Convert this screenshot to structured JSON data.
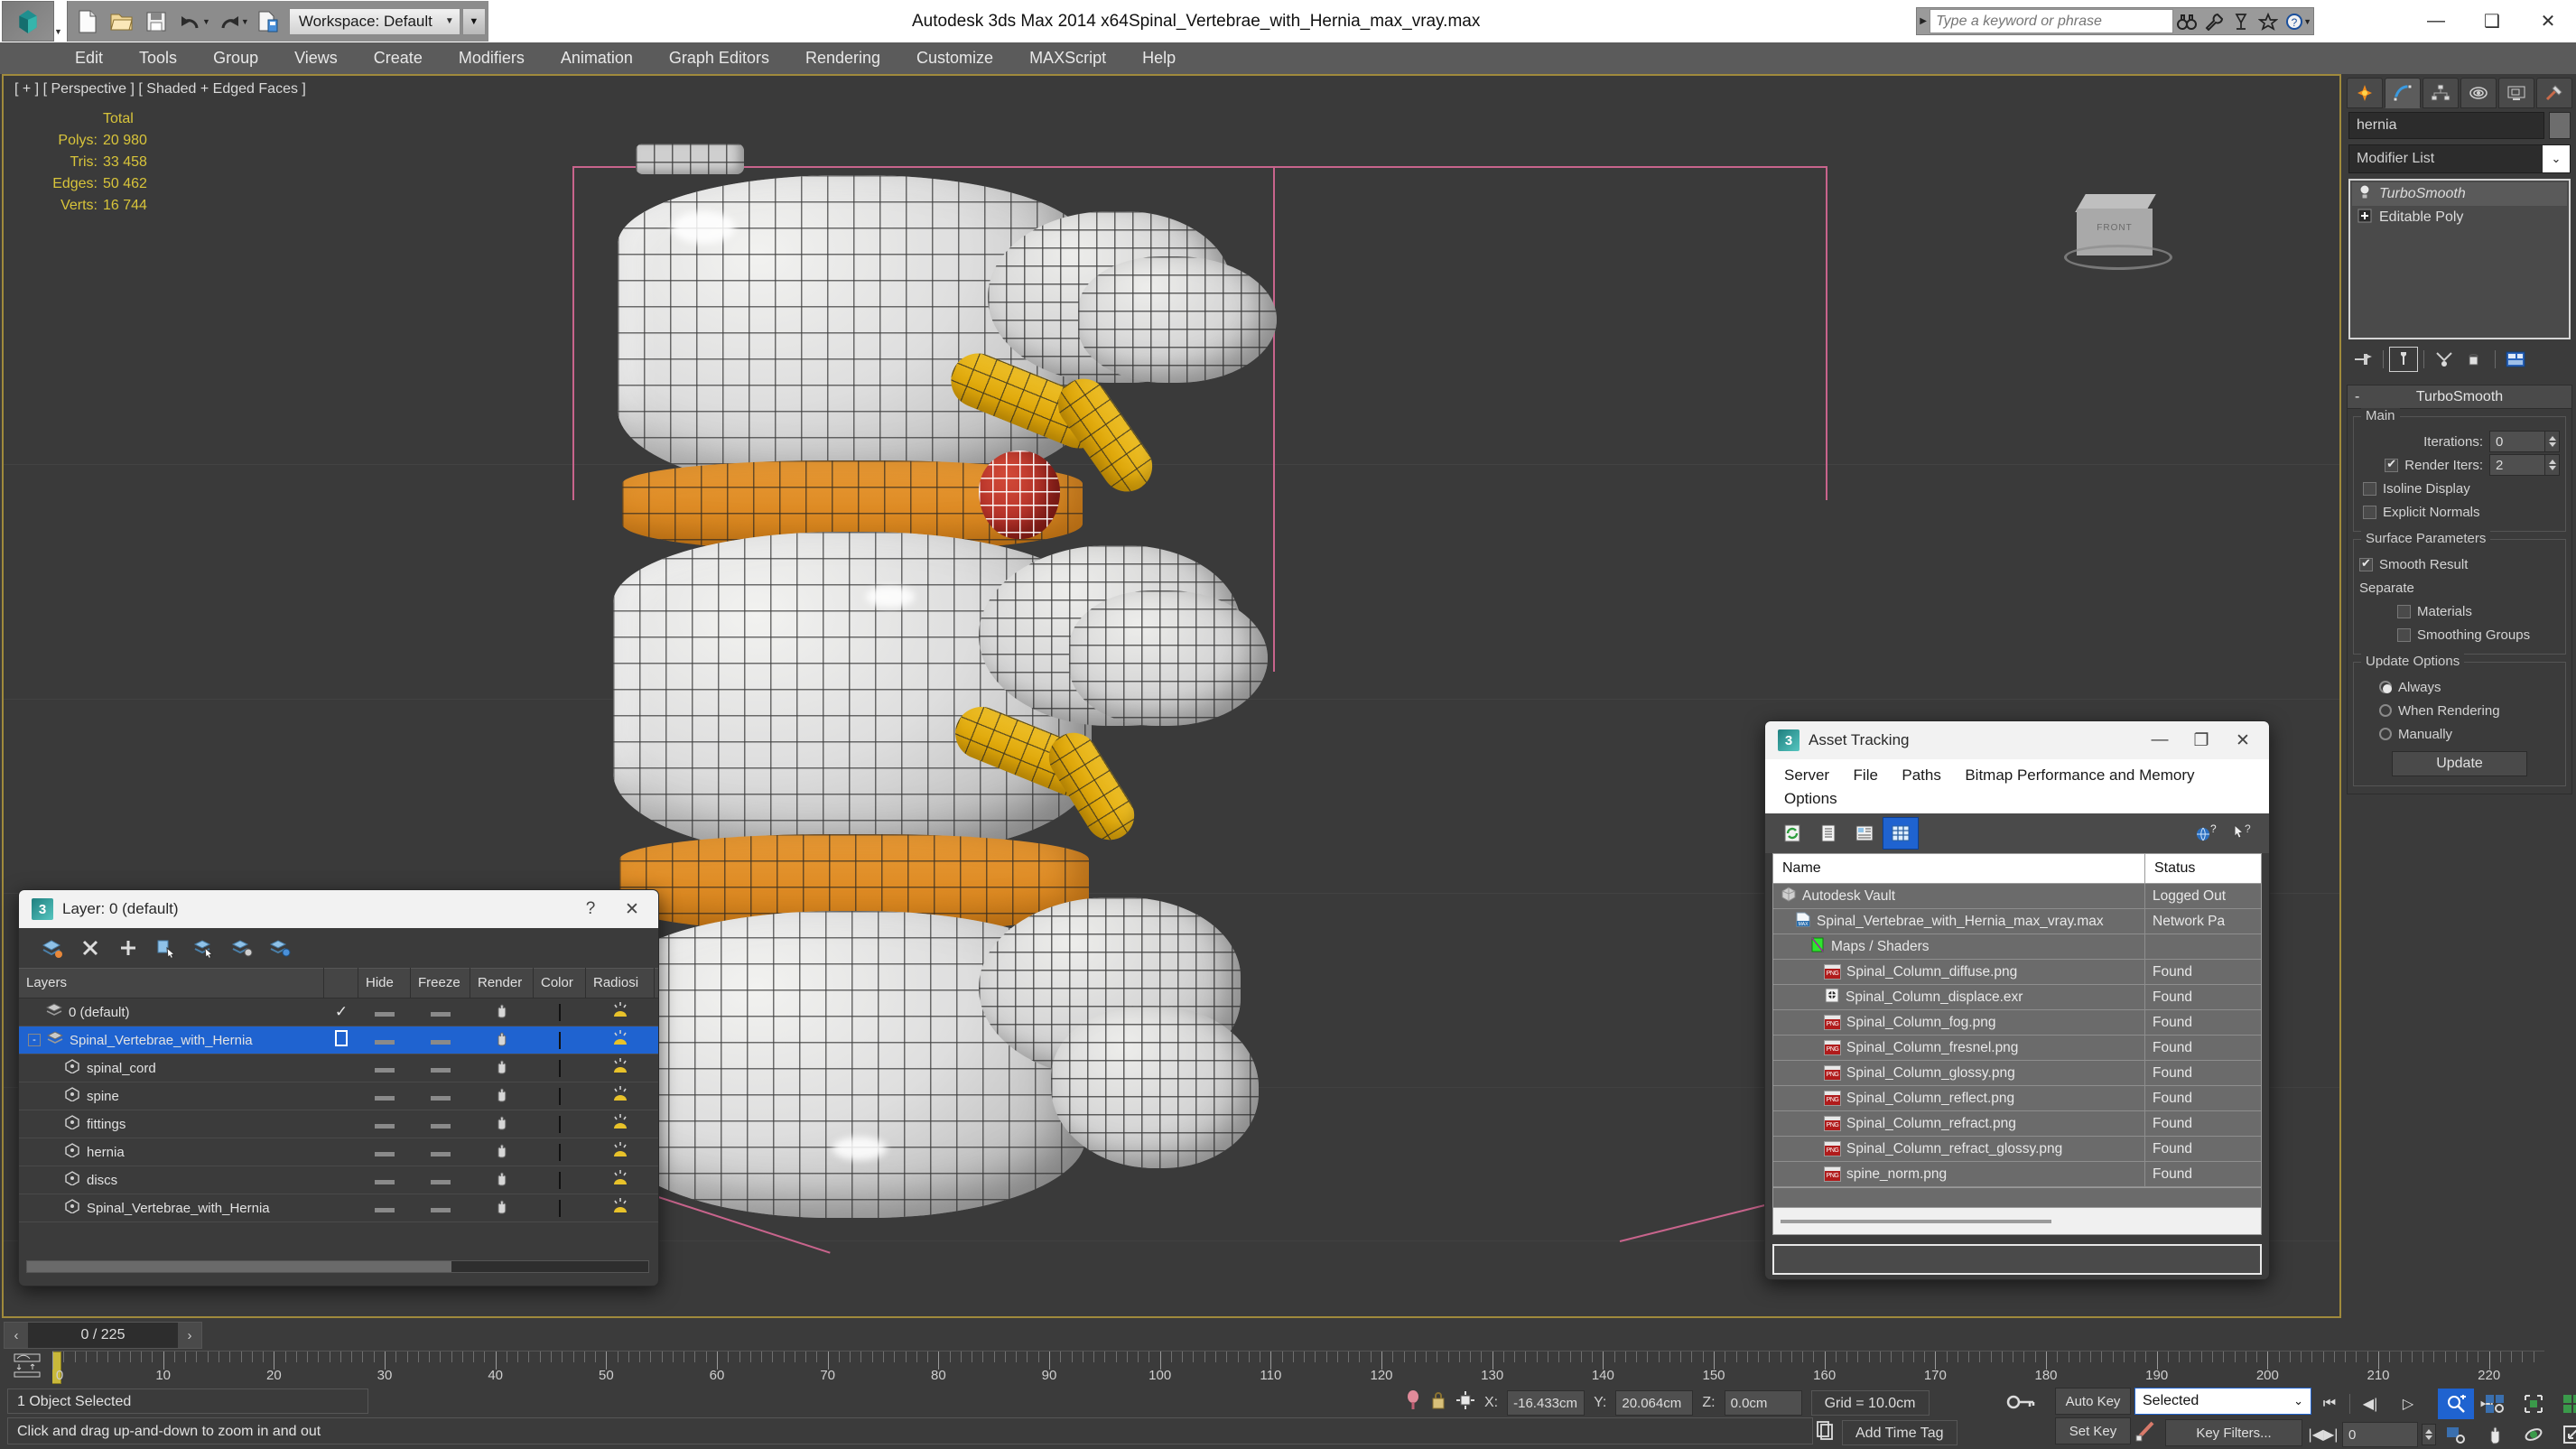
{
  "titlebar": {
    "workspace": "Workspace: Default",
    "app_title": "Autodesk 3ds Max  2014 x64",
    "file_title": "Spinal_Vertebrae_with_Hernia_max_vray.max",
    "search_placeholder": "Type a keyword or phrase",
    "quick_access": [
      "new-file",
      "open-file",
      "save-file",
      "undo",
      "redo",
      "set-project-folder"
    ],
    "window_controls": {
      "minimize": "—",
      "maximize": "❑",
      "close": "✕"
    }
  },
  "menubar": {
    "items": [
      "Edit",
      "Tools",
      "Group",
      "Views",
      "Create",
      "Modifiers",
      "Animation",
      "Graph Editors",
      "Rendering",
      "Customize",
      "MAXScript",
      "Help"
    ]
  },
  "viewport": {
    "label": "[ + ] [ Perspective ] [ Shaded + Edged Faces ]",
    "stats": {
      "header": "Total",
      "rows": [
        {
          "label": "Polys:",
          "value": "20 980"
        },
        {
          "label": "Tris:",
          "value": "33 458"
        },
        {
          "label": "Edges:",
          "value": "50 462"
        },
        {
          "label": "Verts:",
          "value": "16 744"
        }
      ]
    },
    "viewcube_label": "FRONT"
  },
  "layer_dialog": {
    "title": "Layer: 0 (default)",
    "help_btn": "?",
    "close_btn": "✕",
    "toolbar": [
      "new-layer-icon",
      "delete-layer-icon",
      "add-layer-icon",
      "select-objects-in-layer-icon",
      "select-highlighted-objects-icon",
      "highlight-selected-objects-icon",
      "layer-properties-icon"
    ],
    "columns": [
      "Layers",
      "",
      "Hide",
      "Freeze",
      "Render",
      "Color",
      "Radiosi"
    ],
    "rows": [
      {
        "name": "0 (default)",
        "indent": 1,
        "selected": false,
        "current": true,
        "kind": "layer"
      },
      {
        "name": "Spinal_Vertebrae_with_Hernia",
        "indent": 0,
        "selected": true,
        "current": false,
        "kind": "layer"
      },
      {
        "name": "spinal_cord",
        "indent": 2,
        "selected": false,
        "current": false,
        "kind": "object"
      },
      {
        "name": "spine",
        "indent": 2,
        "selected": false,
        "current": false,
        "kind": "object"
      },
      {
        "name": "fittings",
        "indent": 2,
        "selected": false,
        "current": false,
        "kind": "object"
      },
      {
        "name": "hernia",
        "indent": 2,
        "selected": false,
        "current": false,
        "kind": "object"
      },
      {
        "name": "discs",
        "indent": 2,
        "selected": false,
        "current": false,
        "kind": "object"
      },
      {
        "name": "Spinal_Vertebrae_with_Hernia",
        "indent": 2,
        "selected": false,
        "current": false,
        "kind": "object"
      }
    ]
  },
  "asset_tracking": {
    "title": "Asset Tracking",
    "menu": [
      "Server",
      "File",
      "Paths",
      "Bitmap Performance and Memory",
      "Options"
    ],
    "toolbar": [
      "refresh-icon",
      "list-view-icon",
      "details-view-icon",
      "grid-view-icon"
    ],
    "help_icons": [
      "help-globe-icon",
      "help-arrow-icon"
    ],
    "columns": [
      "Name",
      "Status"
    ],
    "rows": [
      {
        "name": "Autodesk Vault",
        "status": "Logged Out",
        "indent": 0,
        "icon": "vault-icon"
      },
      {
        "name": "Spinal_Vertebrae_with_Hernia_max_vray.max",
        "status": "Network Pa",
        "indent": 1,
        "icon": "max-file-icon"
      },
      {
        "name": "Maps / Shaders",
        "status": "",
        "indent": 2,
        "icon": "maps-shaders-icon"
      },
      {
        "name": "Spinal_Column_diffuse.png",
        "status": "Found",
        "indent": 3,
        "icon": "png-icon"
      },
      {
        "name": "Spinal_Column_displace.exr",
        "status": "Found",
        "indent": 3,
        "icon": "exr-icon"
      },
      {
        "name": "Spinal_Column_fog.png",
        "status": "Found",
        "indent": 3,
        "icon": "png-icon"
      },
      {
        "name": "Spinal_Column_fresnel.png",
        "status": "Found",
        "indent": 3,
        "icon": "png-icon"
      },
      {
        "name": "Spinal_Column_glossy.png",
        "status": "Found",
        "indent": 3,
        "icon": "png-icon"
      },
      {
        "name": "Spinal_Column_reflect.png",
        "status": "Found",
        "indent": 3,
        "icon": "png-icon"
      },
      {
        "name": "Spinal_Column_refract.png",
        "status": "Found",
        "indent": 3,
        "icon": "png-icon"
      },
      {
        "name": "Spinal_Column_refract_glossy.png",
        "status": "Found",
        "indent": 3,
        "icon": "png-icon"
      },
      {
        "name": "spine_norm.png",
        "status": "Found",
        "indent": 3,
        "icon": "png-icon"
      }
    ],
    "path_field": "",
    "status_field": ""
  },
  "command_panel": {
    "tabs": [
      "create-tab",
      "modify-tab",
      "hierarchy-tab",
      "motion-tab",
      "display-tab",
      "utilities-tab"
    ],
    "active_tab_index": 1,
    "object_name": "hernia",
    "modifier_list_label": "Modifier List",
    "stack": [
      {
        "label": "TurboSmooth",
        "active": true,
        "icon": "light-bulb-icon"
      },
      {
        "label": "Editable Poly",
        "active": false,
        "icon": "plus-expand-icon"
      }
    ],
    "rollout": {
      "title": "TurboSmooth",
      "minus": "-",
      "groups": [
        {
          "label": "Main",
          "fields": [
            {
              "type": "spinner",
              "label": "Iterations:",
              "value": "0"
            },
            {
              "type": "check_spinner",
              "label": "Render Iters:",
              "value": "2",
              "checked": true
            },
            {
              "type": "checkbox",
              "label": "Isoline Display",
              "checked": false
            },
            {
              "type": "checkbox",
              "label": "Explicit Normals",
              "checked": false
            }
          ]
        },
        {
          "label": "Surface Parameters",
          "fields": [
            {
              "type": "checkbox",
              "label": "Smooth Result",
              "checked": true
            },
            {
              "type": "text",
              "label": "Separate"
            },
            {
              "type": "checkbox_indent",
              "label": "Materials",
              "checked": false
            },
            {
              "type": "checkbox_indent",
              "label": "Smoothing Groups",
              "checked": false
            }
          ]
        },
        {
          "label": "Update Options",
          "fields": [
            {
              "type": "radio",
              "label": "Always",
              "checked": true
            },
            {
              "type": "radio",
              "label": "When Rendering",
              "checked": false
            },
            {
              "type": "radio",
              "label": "Manually",
              "checked": false
            },
            {
              "type": "button",
              "label": "Update"
            }
          ]
        }
      ]
    }
  },
  "timebar": {
    "frame_display": "0 / 225",
    "prev_arrow": "‹",
    "next_arrow": "›",
    "tick_labels": [
      "0",
      "10",
      "20",
      "30",
      "40",
      "50",
      "60",
      "70",
      "80",
      "90",
      "100",
      "110",
      "120",
      "130",
      "140",
      "150",
      "160",
      "170",
      "180",
      "190",
      "200",
      "210",
      "220"
    ],
    "playhead_frame": "0"
  },
  "statusbar": {
    "selection": "1 Object Selected",
    "hint": "Click and drag up-and-down to zoom in and out",
    "coords": {
      "x_label": "X:",
      "x": "-16.433cm",
      "y_label": "Y:",
      "y": "20.064cm",
      "z_label": "Z:",
      "z": "0.0cm"
    },
    "grid": "Grid = 10.0cm",
    "add_time_tag": "Add Time Tag",
    "auto_key": "Auto Key",
    "set_key": "Set Key",
    "key_filters": "Key Filters...",
    "selected_combo": "Selected",
    "key_frame_value": "0",
    "nav_icons": [
      "zoom-icon",
      "zoom-all-icon",
      "zoom-extents-icon",
      "zoom-extents-all-icon",
      "field-of-view-icon",
      "pan-icon",
      "orbit-icon",
      "maximize-viewport-icon"
    ]
  },
  "colors": {
    "accent_blue": "#1f63d0",
    "stats_yellow": "#d8c43a",
    "viewport_border": "#a08a3c",
    "disc_orange": "#dd8a23",
    "nerve_yellow": "#e0a90c",
    "hernia_red": "#b8332a",
    "panel_gray": "#3b3b3b"
  }
}
